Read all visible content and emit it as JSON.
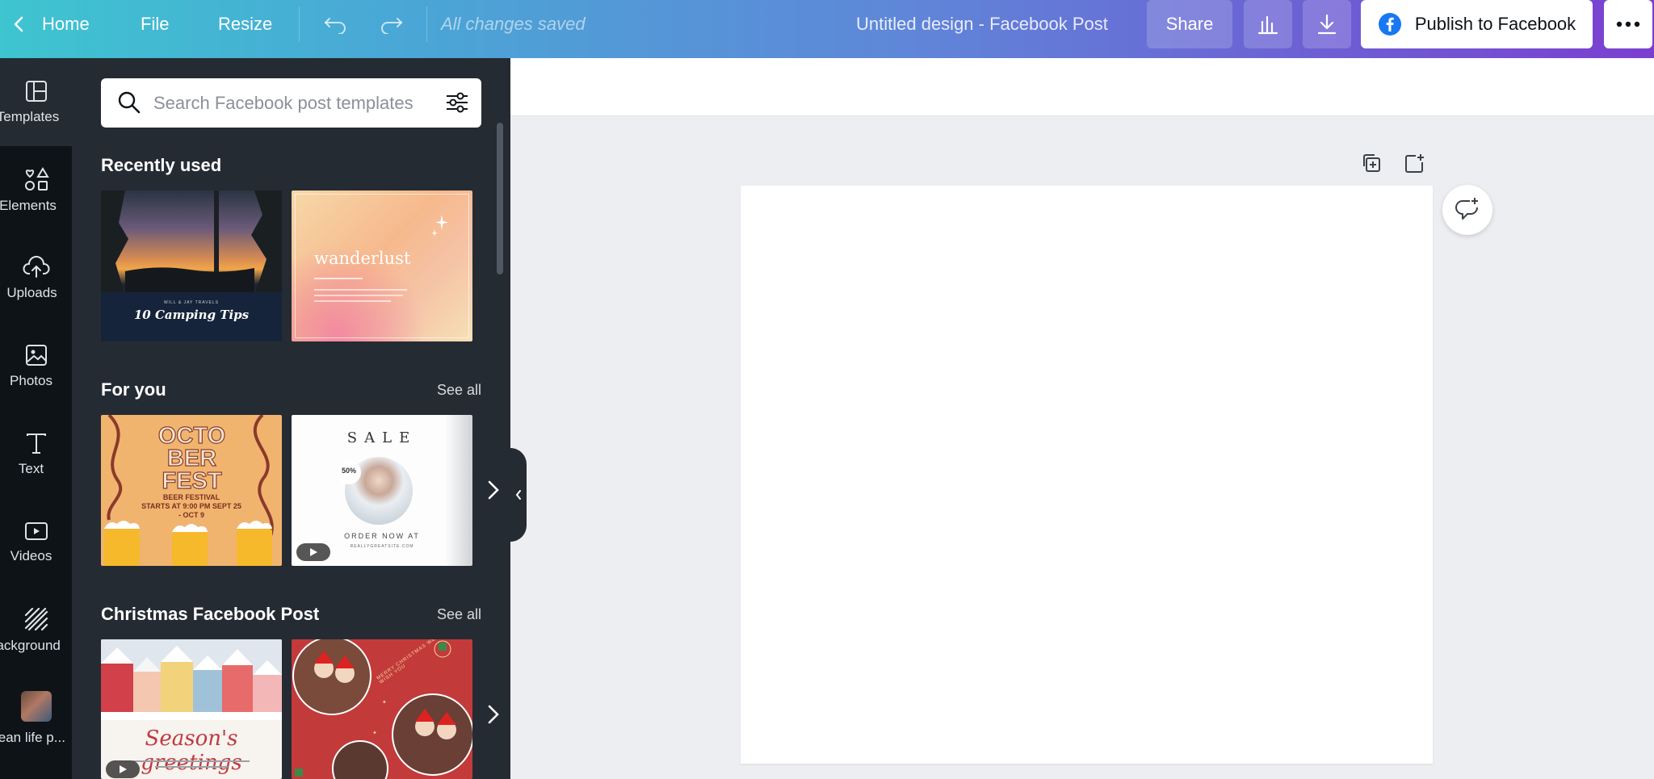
{
  "topbar": {
    "home_label": "Home",
    "file_label": "File",
    "resize_label": "Resize",
    "saved_status": "All changes saved",
    "doc_title": "Untitled design - Facebook Post",
    "share_label": "Share",
    "publish_label": "Publish to Facebook"
  },
  "leftnav": {
    "items": [
      {
        "label": "Templates",
        "icon": "templates-icon"
      },
      {
        "label": "Elements",
        "icon": "elements-icon"
      },
      {
        "label": "Uploads",
        "icon": "upload-icon"
      },
      {
        "label": "Photos",
        "icon": "photos-icon"
      },
      {
        "label": "Text",
        "icon": "text-icon"
      },
      {
        "label": "Videos",
        "icon": "videos-icon"
      },
      {
        "label": "Background",
        "icon": "background-icon"
      },
      {
        "label": "Ocean life p...",
        "icon": "folder-thumbnail"
      }
    ]
  },
  "panel": {
    "search_placeholder": "Search Facebook post templates",
    "sections": [
      {
        "title": "Recently used",
        "see_all": ""
      },
      {
        "title": "For you",
        "see_all": "See all"
      },
      {
        "title": "Christmas Facebook Post",
        "see_all": "See all"
      }
    ],
    "thumbs": {
      "camping_small": "WILL & JAY TRAVELS",
      "camping_title": "10 Camping Tips",
      "wanderlust_title": "wanderlust",
      "octoberfest_title": "OCTO BER FEST",
      "octoberfest_sub": "BEER FESTIVAL",
      "octoberfest_dates": "STARTS AT 9:00 PM SEPT 25 - OCT 9",
      "sale_title": "SALE",
      "sale_badge": "50%",
      "sale_cta": "ORDER NOW AT",
      "sale_site": "REALLYGREATSITE.COM",
      "greetings_title": "Season's greetings",
      "xmas_ring": "MERRY CHRISTMAS WE WISH YOU"
    }
  },
  "colors": {
    "panel_bg": "#252b33",
    "nav_bg": "#0e1318",
    "canvas_bg": "#eceef1",
    "accent": "#7b3fd0",
    "facebook_blue": "#1877f2"
  }
}
